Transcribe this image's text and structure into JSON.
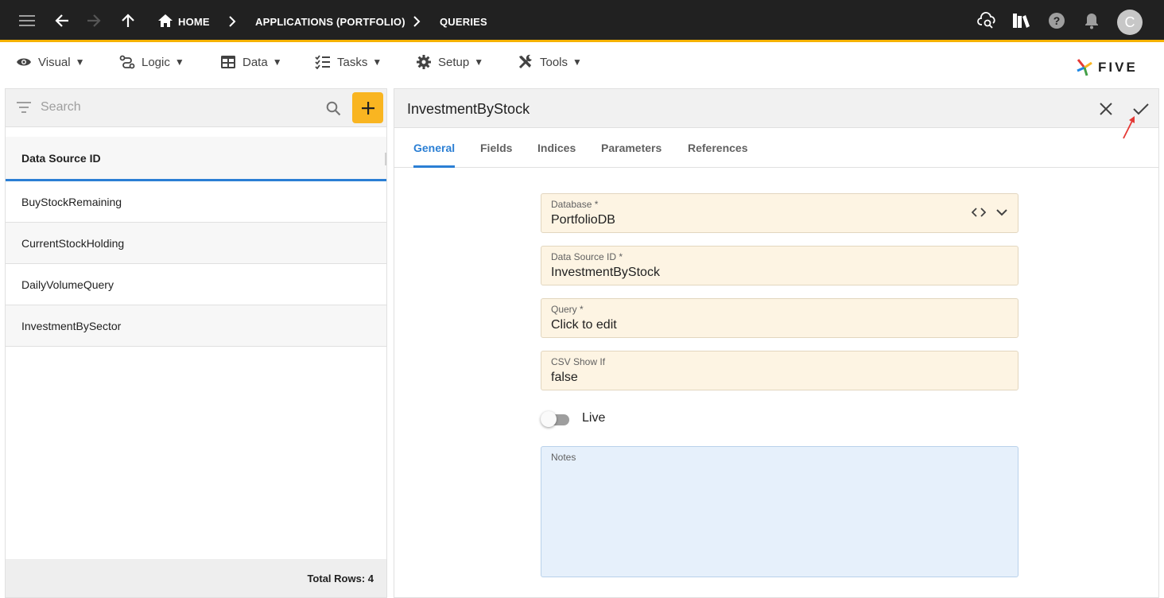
{
  "topbar": {
    "breadcrumbs": [
      "HOME",
      "APPLICATIONS (PORTFOLIO)",
      "QUERIES"
    ],
    "avatar_initial": "C",
    "accent_color": "#f5b200",
    "icons": [
      "menu-icon",
      "back-arrow-icon",
      "forward-arrow-icon",
      "up-arrow-icon",
      "home-icon",
      "cloud-search-icon",
      "library-icon",
      "help-icon",
      "notification-bell-icon"
    ]
  },
  "menubar": {
    "items": [
      {
        "label": "Visual",
        "icon": "eye-icon"
      },
      {
        "label": "Logic",
        "icon": "logic-icon"
      },
      {
        "label": "Data",
        "icon": "table-icon"
      },
      {
        "label": "Tasks",
        "icon": "checklist-icon"
      },
      {
        "label": "Setup",
        "icon": "gear-icon"
      },
      {
        "label": "Tools",
        "icon": "tools-icon"
      }
    ],
    "caret": "▼",
    "brand": "FIVE"
  },
  "list_panel": {
    "search_placeholder": "Search",
    "column_header": "Data Source ID",
    "rows": [
      "BuyStockRemaining",
      "CurrentStockHolding",
      "DailyVolumeQuery",
      "InvestmentBySector"
    ],
    "footer": "Total Rows: 4",
    "add_button_color": "#f9b521",
    "selected_underline_color": "#2b7fd4"
  },
  "form": {
    "title": "InvestmentByStock",
    "tabs": [
      "General",
      "Fields",
      "Indices",
      "Parameters",
      "References"
    ],
    "active_tab": "General",
    "fields": [
      {
        "label": "Database *",
        "value": "PortfolioDB"
      },
      {
        "label": "Data Source ID *",
        "value": "InvestmentByStock"
      },
      {
        "label": "Query *",
        "value": "Click to edit"
      },
      {
        "label": "CSV Show If",
        "value": "false"
      }
    ],
    "live_toggle": {
      "label": "Live",
      "on": false
    },
    "notes_label": "Notes"
  }
}
